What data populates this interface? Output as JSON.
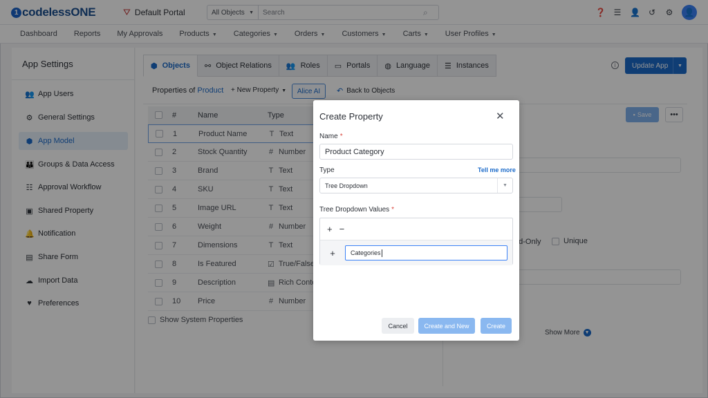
{
  "header": {
    "logo_prefix": "codeless",
    "logo_suffix": "ONE",
    "portal": "Default Portal",
    "search_scope": "All Objects",
    "search_placeholder": "Search"
  },
  "nav": {
    "items": [
      {
        "label": "Dashboard",
        "dropdown": false
      },
      {
        "label": "Reports",
        "dropdown": false
      },
      {
        "label": "My Approvals",
        "dropdown": false
      },
      {
        "label": "Products",
        "dropdown": true
      },
      {
        "label": "Categories",
        "dropdown": true
      },
      {
        "label": "Orders",
        "dropdown": true
      },
      {
        "label": "Customers",
        "dropdown": true
      },
      {
        "label": "Carts",
        "dropdown": true
      },
      {
        "label": "User Profiles",
        "dropdown": true
      }
    ]
  },
  "sidebar": {
    "title": "App Settings",
    "items": [
      {
        "label": "App Users",
        "icon": "users-icon"
      },
      {
        "label": "General Settings",
        "icon": "gear-icon"
      },
      {
        "label": "App Model",
        "icon": "cube-icon",
        "active": true
      },
      {
        "label": "Groups & Data Access",
        "icon": "group-icon"
      },
      {
        "label": "Approval Workflow",
        "icon": "checklist-icon"
      },
      {
        "label": "Shared Property",
        "icon": "shared-box-icon"
      },
      {
        "label": "Notification",
        "icon": "bell-icon"
      },
      {
        "label": "Share Form",
        "icon": "form-icon"
      },
      {
        "label": "Import Data",
        "icon": "cloud-upload-icon"
      },
      {
        "label": "Preferences",
        "icon": "preferences-icon"
      }
    ]
  },
  "tabs": [
    {
      "label": "Objects",
      "icon": "cube-icon",
      "active": true
    },
    {
      "label": "Object Relations",
      "icon": "relations-icon"
    },
    {
      "label": "Roles",
      "icon": "roles-icon"
    },
    {
      "label": "Portals",
      "icon": "monitor-icon"
    },
    {
      "label": "Language",
      "icon": "globe-icon"
    },
    {
      "label": "Instances",
      "icon": "database-icon"
    }
  ],
  "toolbar": {
    "properties_of": "Properties of",
    "object_name": "Product",
    "new_property": "New Property",
    "alice_ai": "Alice AI",
    "back_to_objects": "Back to Objects",
    "update_app": "Update App",
    "save": "Save"
  },
  "table": {
    "headers": {
      "num": "#",
      "name": "Name",
      "type": "Type"
    },
    "rows": [
      {
        "num": "1",
        "name": "Product Name",
        "type": "Text",
        "icon": "T"
      },
      {
        "num": "2",
        "name": "Stock Quantity",
        "type": "Number",
        "icon": "#"
      },
      {
        "num": "3",
        "name": "Brand",
        "type": "Text",
        "icon": "T"
      },
      {
        "num": "4",
        "name": "SKU",
        "type": "Text",
        "icon": "T"
      },
      {
        "num": "5",
        "name": "Image URL",
        "type": "Text",
        "icon": "T"
      },
      {
        "num": "6",
        "name": "Weight",
        "type": "Number",
        "icon": "#"
      },
      {
        "num": "7",
        "name": "Dimensions",
        "type": "Text",
        "icon": "T"
      },
      {
        "num": "8",
        "name": "Is Featured",
        "type": "True/False",
        "icon": "☑"
      },
      {
        "num": "9",
        "name": "Description",
        "type": "Rich Conte",
        "icon": "▤"
      },
      {
        "num": "10",
        "name": "Price",
        "type": "Number",
        "icon": "#"
      }
    ],
    "show_system": "Show System Properties"
  },
  "right_panel": {
    "readonly": "ad-Only",
    "unique": "Unique",
    "show_more": "Show More"
  },
  "modal": {
    "title": "Create Property",
    "name_label": "Name",
    "name_value": "Product Category",
    "type_label": "Type",
    "tell_me_more": "Tell me more",
    "type_value": "Tree Dropdown",
    "tree_label": "Tree Dropdown Values",
    "tree_node_value": "Categories",
    "cancel": "Cancel",
    "create_and_new": "Create and New",
    "create": "Create"
  },
  "colors": {
    "accent": "#1b6ac9",
    "active_bg": "#e6effa",
    "disabled_btn": "#8ab8f0"
  }
}
